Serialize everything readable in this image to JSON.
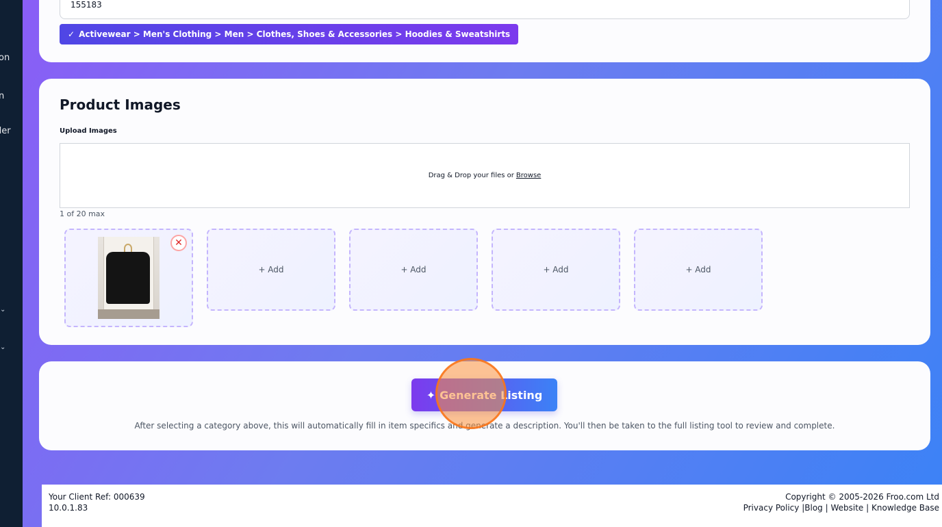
{
  "sidebar": {
    "fragments": [
      "on",
      "n",
      "der"
    ],
    "chevrons": [
      "⌄",
      "⌄"
    ]
  },
  "category": {
    "sku_value": "155183",
    "check": "✓",
    "path": "Activewear > Men's Clothing > Men > Clothes, Shoes & Accessories > Hoodies & Sweatshirts"
  },
  "images": {
    "title": "Product Images",
    "upload_label": "Upload Images",
    "drop_text": "Drag & Drop your files or",
    "browse": "Browse",
    "count": "1 of 20 max",
    "remove": "✕",
    "add_label": "+ Add",
    "slots": [
      {
        "label": "+ Add"
      },
      {
        "label": "+ Add"
      },
      {
        "label": "+ Add"
      },
      {
        "label": "+ Add"
      }
    ]
  },
  "generate": {
    "icon": "✦",
    "label": "Generate Listing",
    "hint": "After selecting a category above, this will automatically fill in item specifics and generate a description. You'll then be taken to the full listing tool to review and complete."
  },
  "footer": {
    "client_ref": "Your Client Ref: 000639",
    "version": "10.0.1.83",
    "copyright": "Copyright © 2005-2026 Froo.com Ltd",
    "links": {
      "privacy": "Privacy Policy",
      "blog": "Blog",
      "website": "Website",
      "kb": "Knowledge Base"
    }
  },
  "colors": {
    "accent_start": "#7c3aed",
    "accent_end": "#3b82f6",
    "remove": "#dc2626",
    "click_indicator": "#f97316"
  }
}
